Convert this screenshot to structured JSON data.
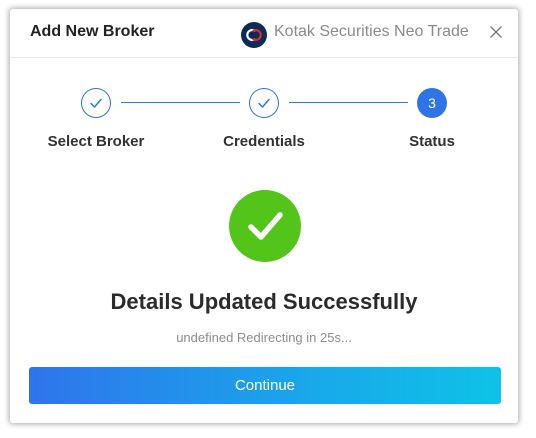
{
  "header": {
    "title": "Add New Broker",
    "broker_name": "Kotak Securities Neo Trade",
    "broker_logo_icon": "kotak-logo-icon",
    "close_icon": "close-icon"
  },
  "steps": [
    {
      "label": "Select Broker",
      "state": "done",
      "icon": "check-icon"
    },
    {
      "label": "Credentials",
      "state": "done",
      "icon": "check-icon"
    },
    {
      "label": "Status",
      "state": "active",
      "number": "3"
    }
  ],
  "status": {
    "icon": "success-check-icon",
    "headline": "Details Updated Successfully",
    "subtext": "undefined Redirecting in 25s..."
  },
  "actions": {
    "continue_label": "Continue"
  },
  "colors": {
    "accent": "#2e74e6",
    "success": "#52c41a",
    "button_gradient_start": "#2f74ec",
    "button_gradient_end": "#0dc3e6"
  }
}
